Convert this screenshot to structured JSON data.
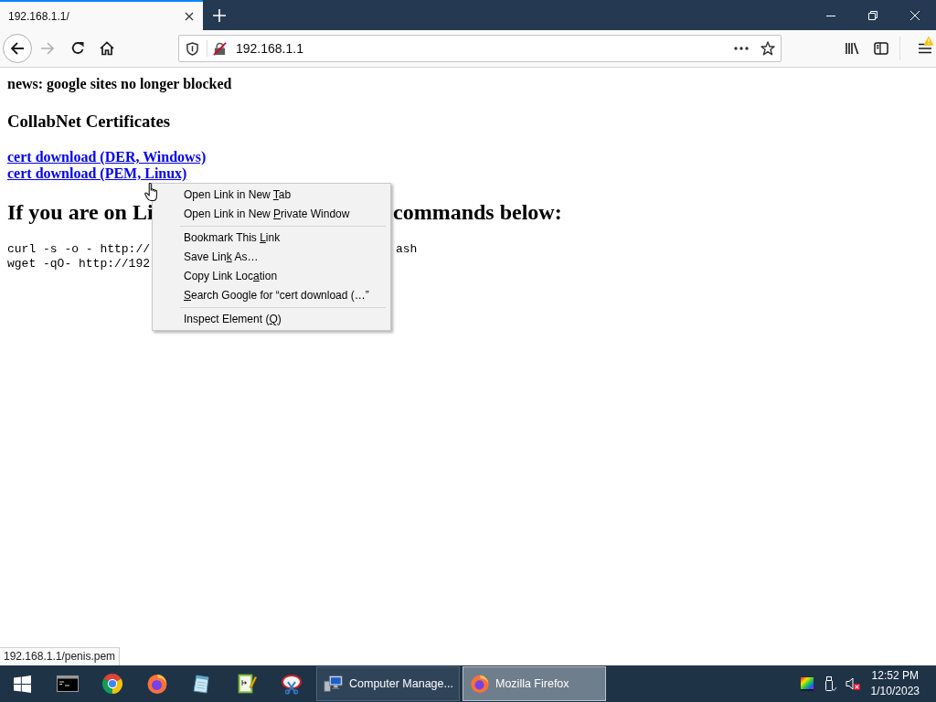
{
  "window": {
    "tabs": [
      {
        "title": "192.168.1.1/",
        "selected": true
      }
    ]
  },
  "toolbar": {
    "forward_disabled": true,
    "address": "192.168.1.1",
    "menu_alert": true
  },
  "page": {
    "news": "news: google sites no longer blocked",
    "section_title": "CollabNet Certificates",
    "links": [
      "cert download (DER, Windows)",
      "cert download (PEM, Linux)"
    ],
    "heading": {
      "left": "If you are on Li",
      "right": "commands below:"
    },
    "code_lines": [
      {
        "left": "curl -s -o - http://",
        "right": "ash"
      },
      {
        "left": "wget -qO- http://192"
      }
    ]
  },
  "context_menu": {
    "items": [
      {
        "kind": "item",
        "before": "Open Link in New ",
        "key": "T",
        "after": "ab"
      },
      {
        "kind": "item",
        "before": "Open Link in New ",
        "key": "P",
        "after": "rivate Window"
      },
      {
        "kind": "separator"
      },
      {
        "kind": "item",
        "before": "Bookmark This ",
        "key": "L",
        "after": "ink"
      },
      {
        "kind": "item",
        "before": "Save Lin",
        "key": "k",
        "after": " As…"
      },
      {
        "kind": "item",
        "before": "Copy Link Loc",
        "key": "a",
        "after": "tion"
      },
      {
        "kind": "item",
        "key": "S",
        "after": "earch Google for “cert download (…”"
      },
      {
        "kind": "separator"
      },
      {
        "kind": "item",
        "before": "Inspect Element (",
        "key": "Q",
        "after": ")"
      }
    ]
  },
  "status_bar": {
    "link": "192.168.1.1/penis.pem"
  },
  "taskbar": {
    "windows": [
      {
        "kind": "computer",
        "label": "Computer Manage...",
        "selected": false
      },
      {
        "kind": "firefox",
        "label": "Mozilla Firefox",
        "selected": true
      }
    ],
    "tray": {
      "muted": true,
      "time": "12:52 PM",
      "date": "1/10/2023"
    }
  }
}
